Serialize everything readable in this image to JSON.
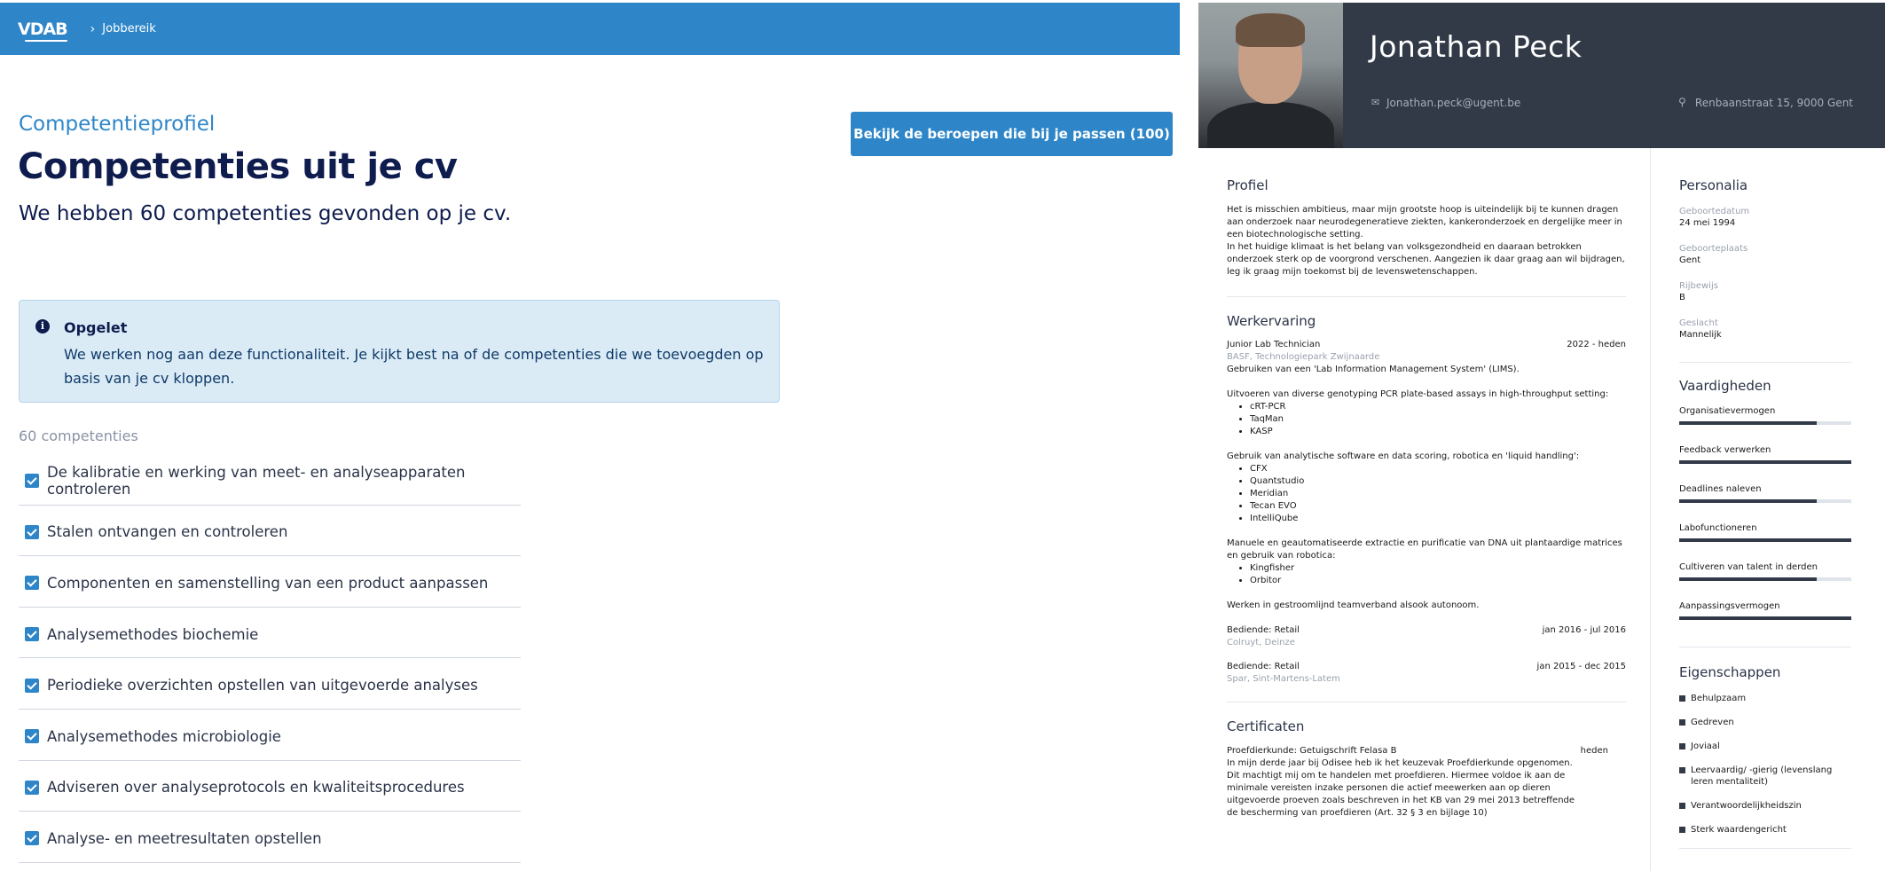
{
  "header": {
    "logo": "VDAB",
    "breadcrumb": "Jobbereik"
  },
  "page": {
    "subtitle": "Competentieprofiel",
    "title": "Competenties uit je cv",
    "lead": "We hebben 60 competenties gevonden op je cv.",
    "match_button": "Bekijk de beroepen die bij je passen (100)"
  },
  "notice": {
    "title": "Opgelet",
    "text": "We werken nog aan deze functionaliteit. Je kijkt best na of de competenties die we toevoegden op basis van je cv kloppen."
  },
  "competencies": {
    "count_label": "60 competenties",
    "items": [
      "De kalibratie en werking van meet- en analyseapparaten controleren",
      "Stalen ontvangen en controleren",
      "Componenten en samenstelling van een product aanpassen",
      "Analysemethodes biochemie",
      "Periodieke overzichten opstellen van uitgevoerde analyses",
      "Analysemethodes microbiologie",
      "Adviseren over analyseprotocols en kwaliteitsprocedures",
      "Analyse- en meetresultaten opstellen"
    ]
  },
  "cv": {
    "name": "Jonathan Peck",
    "email": "Jonathan.peck@ugent.be",
    "address": "Renbaanstraat 15, 9000 Gent",
    "profile": {
      "heading": "Profiel",
      "text": "Het is misschien ambitieus, maar mijn grootste hoop is uiteindelijk bij te kunnen dragen aan onderzoek naar neurodegeneratieve ziekten, kankeronderzoek en dergelijke meer in een biotechnologische setting.\nIn het huidige klimaat is het belang van volksgezondheid en daaraan betrokken onderzoek sterk op de voorgrond verschenen. Aangezien ik daar graag aan wil bijdragen, leg ik graag mijn toekomst bij de levenswetenschappen."
    },
    "experience": {
      "heading": "Werkervaring",
      "job1": {
        "title": "Junior Lab Technician",
        "period": "2022 - heden",
        "org": "BASF, Technologiepark Zwijnaarde",
        "p1": "Gebruiken van een 'Lab Information Management System' (LIMS).",
        "p2": "Uitvoeren van diverse genotyping PCR plate-based assays in high-throughput setting:",
        "list1": [
          "cRT-PCR",
          "TaqMan",
          "KASP"
        ],
        "p3": "Gebruik van analytische software en data scoring, robotica en 'liquid handling':",
        "list2": [
          "CFX",
          "Quantstudio",
          "Meridian",
          "Tecan EVO",
          "IntelliQube"
        ],
        "p4": "Manuele en geautomatiseerde extractie en purificatie van DNA uit plantaardige matrices en gebruik van robotica:",
        "list3": [
          "Kingfisher",
          "Orbitor"
        ],
        "p5": "Werken in gestroomlijnd teamverband alsook autonoom."
      },
      "job2": {
        "title": "Bediende: Retail",
        "period": "jan 2016 - jul 2016",
        "org": "Colruyt, Deinze"
      },
      "job3": {
        "title": "Bediende: Retail",
        "period": "jan 2015 - dec 2015",
        "org": "Spar, Sint-Martens-Latem"
      }
    },
    "certificates": {
      "heading": "Certificaten",
      "title": "Proefdierkunde: Getuigschrift Felasa B",
      "period": "heden",
      "text": "In mijn derde jaar bij Odisee heb ik het keuzevak Proefdierkunde opgenomen. Dit machtigt mij om te handelen met proefdieren. Hiermee voldoe ik aan de minimale vereisten inzake personen die actief meewerken aan op dieren uitgevoerde proeven zoals beschreven in het KB van 29 mei 2013 betreffende de bescherming van proefdieren (Art. 32 § 3 en bijlage 10)"
    },
    "personal": {
      "heading": "Personalia",
      "birthdate_label": "Geboortedatum",
      "birthdate": "24 mei 1994",
      "birthplace_label": "Geboorteplaats",
      "birthplace": "Gent",
      "license_label": "Rijbewijs",
      "license": "B",
      "gender_label": "Geslacht",
      "gender": "Mannelijk"
    },
    "skills": {
      "heading": "Vaardigheden",
      "items": [
        {
          "name": "Organisatievermogen",
          "level": 0.8
        },
        {
          "name": "Feedback verwerken",
          "level": 1.0
        },
        {
          "name": "Deadlines naleven",
          "level": 0.8
        },
        {
          "name": "Labofunctioneren",
          "level": 1.0
        },
        {
          "name": "Cultiveren van talent in derden",
          "level": 0.8
        },
        {
          "name": "Aanpassingsvermogen",
          "level": 1.0
        }
      ]
    },
    "traits": {
      "heading": "Eigenschappen",
      "items": [
        "Behulpzaam",
        "Gedreven",
        "Joviaal",
        "Leervaardig/ -gierig (levenslang leren mentaliteit)",
        "Verantwoordelijkheidszin",
        "Sterk waardengericht"
      ]
    }
  }
}
